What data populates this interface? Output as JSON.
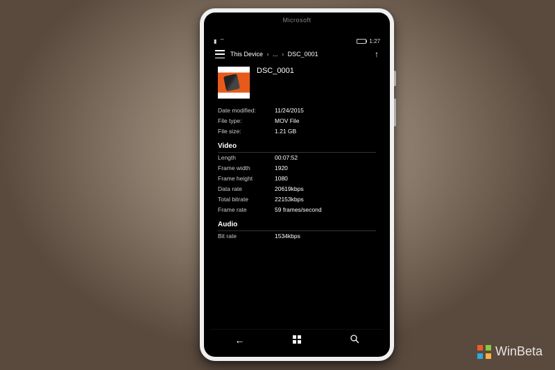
{
  "device": {
    "brand": "Microsoft"
  },
  "status": {
    "time": "1:27"
  },
  "header": {
    "breadcrumb": {
      "root": "This Device",
      "ellipsis": "...",
      "current": "DSC_0001"
    }
  },
  "file": {
    "name": "DSC_0001",
    "date_modified_label": "Date modified:",
    "date_modified": "11/24/2015",
    "file_type_label": "File type:",
    "file_type": "MOV File",
    "file_size_label": "File size:",
    "file_size": "1.21 GB"
  },
  "video": {
    "section": "Video",
    "length_label": "Length",
    "length": "00:07:52",
    "frame_width_label": "Frame width",
    "frame_width": "1920",
    "frame_height_label": "Frame height",
    "frame_height": "1080",
    "data_rate_label": "Data rate",
    "data_rate": "20619kbps",
    "total_bitrate_label": "Total bitrate",
    "total_bitrate": "22153kbps",
    "frame_rate_label": "Frame rate",
    "frame_rate": "59 frames/second"
  },
  "audio": {
    "section": "Audio",
    "bit_rate_label": "Bit rate",
    "bit_rate": "1534kbps"
  },
  "watermark": {
    "text": "WinBeta"
  }
}
